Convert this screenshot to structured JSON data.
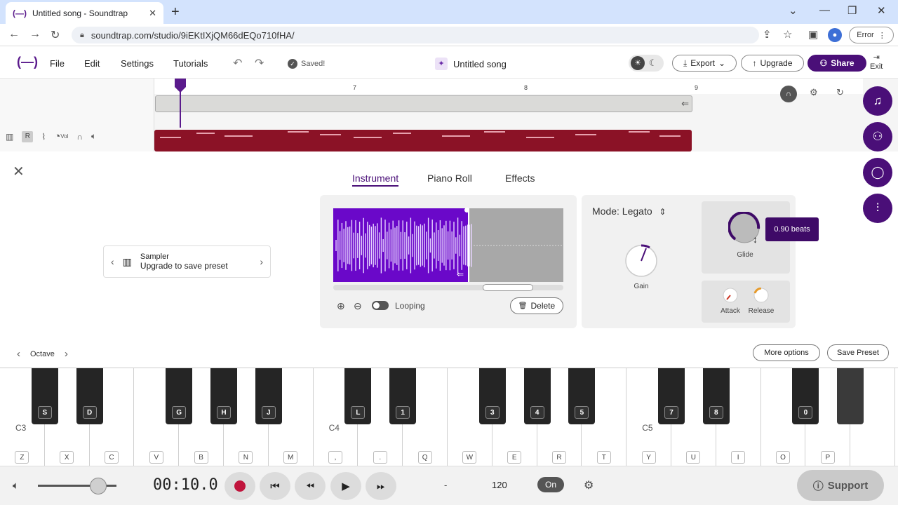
{
  "browser": {
    "tab_title": "Untitled song - Soundtrap",
    "tab_logo": "(—)",
    "url": "soundtrap.com/studio/9iEKtIXjQM66dEQo710fHA/",
    "error_label": "Error"
  },
  "header": {
    "logo": "(—)",
    "menu": [
      "File",
      "Edit",
      "Settings",
      "Tutorials"
    ],
    "saved_label": "Saved!",
    "song_title": "Untitled song",
    "export_label": "Export",
    "upgrade_label": "Upgrade",
    "share_label": "Share",
    "exit_label": "Exit"
  },
  "timeline": {
    "ruler_marks": [
      "7",
      "8",
      "9"
    ],
    "track_buttons": {
      "record_arm": "R",
      "vol": "Vol"
    }
  },
  "instrument_panel": {
    "tabs": [
      "Instrument",
      "Piano Roll",
      "Effects"
    ],
    "active_tab": "Instrument",
    "preset_name": "Sampler",
    "preset_sub": "Upgrade to save preset",
    "looping_label": "Looping",
    "delete_label": "Delete",
    "mode_label": "Mode: Legato",
    "gain_label": "Gain",
    "glide_label": "Glide",
    "attack_label": "Attack",
    "release_label": "Release",
    "glide_tooltip": "0.90 beats",
    "octave_label": "Octave",
    "more_options_label": "More options",
    "save_preset_label": "Save Preset"
  },
  "keyboard": {
    "white_keys": [
      "Z",
      "X",
      "C",
      "V",
      "B",
      "N",
      "M",
      ",",
      ".",
      "Q",
      "W",
      "E",
      "R",
      "T",
      "Y",
      "U",
      "I",
      "O",
      "P",
      ""
    ],
    "black_keys": [
      "S",
      "D",
      "G",
      "H",
      "J",
      "L",
      "1",
      "3",
      "4",
      "5",
      "7",
      "8",
      "0",
      ""
    ],
    "octave_labels": [
      "C3",
      "C4",
      "C5"
    ]
  },
  "transport": {
    "time": "00:10.0",
    "dash": "-",
    "tempo": "120",
    "metronome": "On",
    "support_label": "Support"
  },
  "colors": {
    "brand": "#4a0f78",
    "region": "#8b1226",
    "sample_selection": "#6a08c9"
  }
}
